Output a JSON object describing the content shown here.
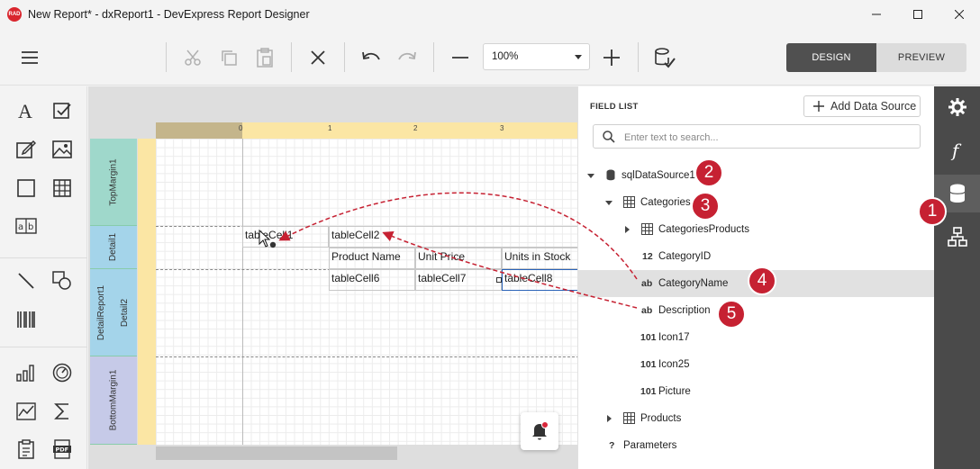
{
  "window": {
    "logo_text": "RAD",
    "title": "New Report* - dxReport1 - DevExpress Report Designer"
  },
  "toolbar": {
    "zoom_value": "100%",
    "design_label": "DESIGN",
    "preview_label": "PREVIEW"
  },
  "surface": {
    "ruler_numbers": [
      "0",
      "1",
      "2",
      "3"
    ],
    "bands": [
      "TopMargin1",
      "Detail1",
      "DetailReport1",
      "Detail2",
      "BottomMargin1"
    ],
    "cells": {
      "tablecell1": "tableCell1",
      "tablecell2": "tableCell2",
      "product_name": "Product Name",
      "unit_price": "Unit Price",
      "units_in_stock": "Units in Stock",
      "tablecell6": "tableCell6",
      "tablecell7": "tableCell7",
      "tablecell8": "tableCell8"
    }
  },
  "field_list": {
    "title": "FIELD LIST",
    "add_data_source": "Add Data Source",
    "search_placeholder": "Enter text to search...",
    "tree": {
      "sqldatasource": "sqlDataSource1",
      "categories": "Categories",
      "categories_products": "CategoriesProducts",
      "category_id": {
        "badge": "12",
        "label": "CategoryID"
      },
      "category_name": {
        "badge": "ab",
        "label": "CategoryName"
      },
      "description": {
        "badge": "ab",
        "label": "Description"
      },
      "icon17": {
        "badge": "101",
        "label": "Icon17"
      },
      "icon25": {
        "badge": "101",
        "label": "Icon25"
      },
      "picture": {
        "badge": "101",
        "label": "Picture"
      },
      "products": "Products",
      "parameters": {
        "badge": "?",
        "label": "Parameters"
      }
    }
  },
  "callouts": [
    "1",
    "2",
    "3",
    "4",
    "5"
  ],
  "colors": {
    "callout": "#c62132",
    "rightbar": "#4a4a4a",
    "design_active": "#505050",
    "top_margin_band": "#9fd8cb",
    "detail_band": "#a4d4ea",
    "bottom_margin_band": "#c6cae8",
    "ruler": "#fbe6a4"
  },
  "icons": [
    "settings-gear",
    "function",
    "database",
    "report-explorer"
  ]
}
